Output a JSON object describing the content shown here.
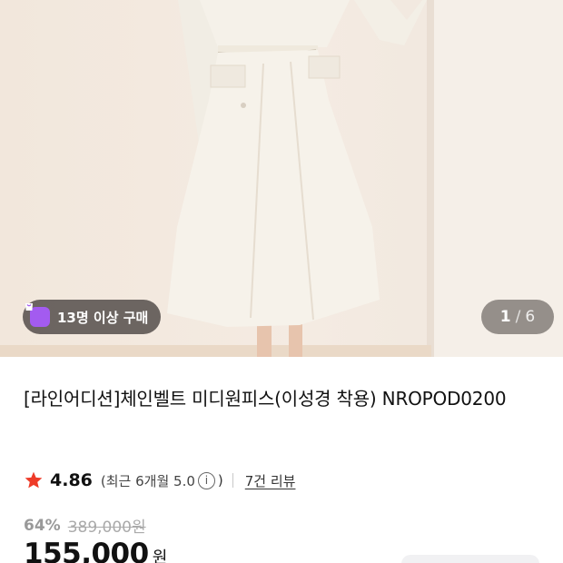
{
  "hero": {
    "badge": {
      "icon": "shopping-bag-icon",
      "text": "13명 이상 구매"
    },
    "counter": {
      "current": "1",
      "separator": "/",
      "total": "6"
    }
  },
  "product": {
    "title": "[라인어디션]체인벨트 미디원피스(이성경 착용) NROPOD0200"
  },
  "rating": {
    "icon": "star-icon",
    "score": "4.86",
    "recent": "(최근 6개월 5.0",
    "close_paren": ")",
    "info_icon": "info-icon",
    "reviews": "7건 리뷰",
    "star_color": "#ee3b28"
  },
  "price": {
    "discount": "64%",
    "original": "389,000원",
    "sale": "155,000",
    "currency": "원"
  }
}
